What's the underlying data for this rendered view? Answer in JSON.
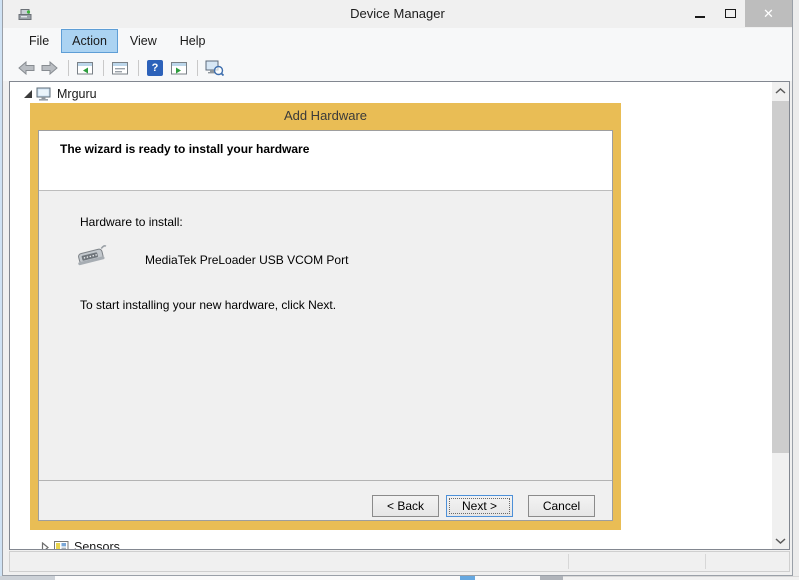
{
  "window": {
    "title": "Device Manager"
  },
  "menu": {
    "items": [
      {
        "label": "File"
      },
      {
        "label": "Action"
      },
      {
        "label": "View"
      },
      {
        "label": "Help"
      }
    ]
  },
  "toolbar": {
    "buttons": [
      "back",
      "forward",
      "show-console-tree",
      "properties",
      "help",
      "show-action-pane",
      "scan-for-hardware-changes"
    ]
  },
  "tree": {
    "items": [
      {
        "label": "Mrguru",
        "state": "expanded"
      },
      {
        "label": "Sensors",
        "state": "collapsed"
      }
    ]
  },
  "dialog": {
    "title": "Add Hardware",
    "heading": "The wizard is ready to install your hardware",
    "hardware_label": "Hardware to install:",
    "device_name": "MediaTek PreLoader USB VCOM Port",
    "instruction": "To start installing your new hardware, click Next.",
    "buttons": {
      "back": "< Back",
      "next": "Next >",
      "cancel": "Cancel"
    }
  },
  "icons": {
    "help_glyph": "?",
    "close_glyph": "✕"
  },
  "colors": {
    "dialog_accent": "#e9bd55",
    "help_blue": "#2d62ba",
    "focus_border": "#4d90d8",
    "menu_highlight": "#abd3f2",
    "close_button_bg": "#bdbdbd"
  },
  "status_bar": {
    "panes": [
      "",
      "",
      ""
    ]
  }
}
